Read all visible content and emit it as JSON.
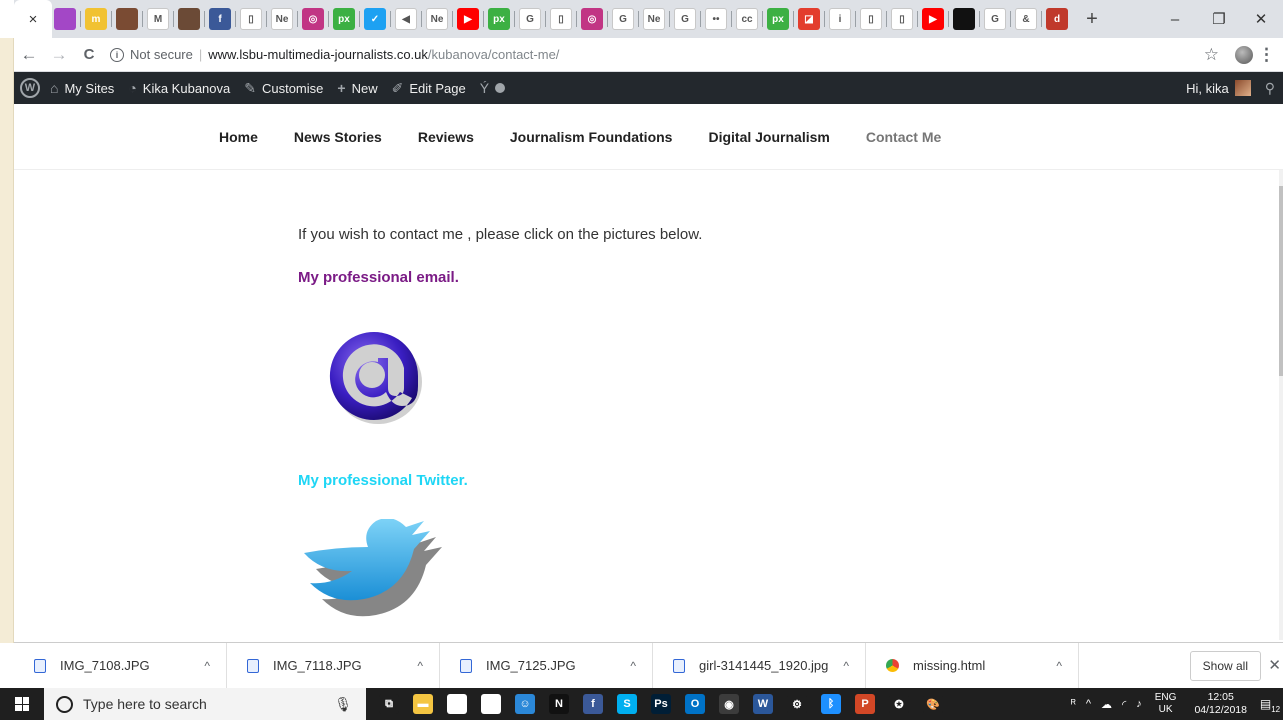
{
  "browser": {
    "active_tab_close": "×",
    "tabs": [
      {
        "icon": "purple-square-icon",
        "color": "#a347c6",
        "text": ""
      },
      {
        "icon": "site-logo-icon",
        "color": "#f1c232",
        "text": "m"
      },
      {
        "icon": "person-photo-icon",
        "color": "#7a4b33",
        "text": ""
      },
      {
        "icon": "gmail-icon",
        "color": "#ffffff",
        "text": "M"
      },
      {
        "icon": "person-photo-icon",
        "color": "#6b4a36",
        "text": ""
      },
      {
        "icon": "facebook-icon",
        "color": "#3b5998",
        "text": "f"
      },
      {
        "icon": "page-icon",
        "color": "#ffffff",
        "text": "▯"
      },
      {
        "icon": "ne-icon",
        "color": "#ffffff",
        "text": "Ne"
      },
      {
        "icon": "instagram-icon",
        "color": "#c13584",
        "text": "◎"
      },
      {
        "icon": "px-icon",
        "color": "#3cb043",
        "text": "px"
      },
      {
        "icon": "twitter-icon",
        "color": "#1da1f2",
        "text": "✓"
      },
      {
        "icon": "audio-icon",
        "color": "#ffffff",
        "text": "◀"
      },
      {
        "icon": "ne-icon",
        "color": "#ffffff",
        "text": "Ne"
      },
      {
        "icon": "youtube-icon",
        "color": "#ff0000",
        "text": "▶"
      },
      {
        "icon": "px-icon",
        "color": "#3cb043",
        "text": "px"
      },
      {
        "icon": "google-icon",
        "color": "#ffffff",
        "text": "G"
      },
      {
        "icon": "page-icon",
        "color": "#ffffff",
        "text": "▯"
      },
      {
        "icon": "instagram-icon",
        "color": "#c13584",
        "text": "◎"
      },
      {
        "icon": "google-icon",
        "color": "#ffffff",
        "text": "G"
      },
      {
        "icon": "ne-icon",
        "color": "#ffffff",
        "text": "Ne"
      },
      {
        "icon": "google-icon",
        "color": "#ffffff",
        "text": "G"
      },
      {
        "icon": "flickr-icon",
        "color": "#ffffff",
        "text": "••"
      },
      {
        "icon": "creative-commons-icon",
        "color": "#ffffff",
        "text": "cc"
      },
      {
        "icon": "px-icon",
        "color": "#3cb043",
        "text": "px"
      },
      {
        "icon": "red-app-icon",
        "color": "#e33d2d",
        "text": "◪"
      },
      {
        "icon": "info-icon",
        "color": "#ffffff",
        "text": "i"
      },
      {
        "icon": "page-icon",
        "color": "#ffffff",
        "text": "▯"
      },
      {
        "icon": "page-icon",
        "color": "#ffffff",
        "text": "▯"
      },
      {
        "icon": "youtube-icon",
        "color": "#ff0000",
        "text": "▶"
      },
      {
        "icon": "black-square-icon",
        "color": "#111111",
        "text": ""
      },
      {
        "icon": "google-icon",
        "color": "#ffffff",
        "text": "G"
      },
      {
        "icon": "link-icon",
        "color": "#ffffff",
        "text": "&"
      },
      {
        "icon": "red-circle-icon",
        "color": "#c0392b",
        "text": "d"
      }
    ],
    "new_tab": "+",
    "window_controls": {
      "minimize": "–",
      "maximize": "❐",
      "close": "✕"
    },
    "nav": {
      "back": "←",
      "forward": "→",
      "reload": "C"
    },
    "omnibox": {
      "security": "Not secure",
      "host": "www.lsbu-multimedia-journalists.co.uk",
      "path": "/kubanova/contact-me/"
    }
  },
  "wp_admin_bar": {
    "items": [
      {
        "icon": "sites-icon",
        "label": "My Sites"
      },
      {
        "icon": "dashboard-icon",
        "label": "Kika Kubanova"
      },
      {
        "icon": "brush-icon",
        "label": "Customise"
      },
      {
        "icon": "plus-icon",
        "label": "New"
      },
      {
        "icon": "pencil-icon",
        "label": "Edit Page"
      }
    ],
    "greeting": "Hi, kika"
  },
  "site_nav": {
    "items": [
      "Home",
      "News Stories",
      "Reviews",
      "Journalism Foundations",
      "Digital Journalism",
      "Contact Me"
    ],
    "current": "Contact Me"
  },
  "content": {
    "intro": "If you wish to contact me , please click on the pictures below.",
    "email_heading": "My professional email.",
    "twitter_heading": "My professional Twitter.",
    "colors": {
      "email_heading": "#7b1b86",
      "twitter_heading": "#1ed6f5"
    }
  },
  "downloads": {
    "files": [
      {
        "name": "IMG_7108.JPG",
        "icon": "image-file-icon"
      },
      {
        "name": "IMG_7118.JPG",
        "icon": "image-file-icon"
      },
      {
        "name": "IMG_7125.JPG",
        "icon": "image-file-icon"
      },
      {
        "name": "girl-3141445_1920.jpg",
        "icon": "image-file-icon"
      },
      {
        "name": "missing.html",
        "icon": "chrome-file-icon"
      }
    ],
    "show_all": "Show all"
  },
  "taskbar": {
    "search_placeholder": "Type here to search",
    "apps": [
      {
        "icon": "task-view-icon",
        "color": "#1f1f1f",
        "text": "⧉"
      },
      {
        "icon": "file-explorer-icon",
        "color": "#f4c542",
        "text": "▬"
      },
      {
        "icon": "store-icon",
        "color": "#ffffff",
        "text": "🛍"
      },
      {
        "icon": "mail-icon",
        "color": "#ffffff",
        "text": "✉"
      },
      {
        "icon": "people-icon",
        "color": "#2b88d8",
        "text": "☺"
      },
      {
        "icon": "netflix-icon",
        "color": "#111111",
        "text": "N"
      },
      {
        "icon": "facebook-icon",
        "color": "#3b5998",
        "text": "f"
      },
      {
        "icon": "skype-icon",
        "color": "#00aff0",
        "text": "S"
      },
      {
        "icon": "photoshop-icon",
        "color": "#001e36",
        "text": "Ps"
      },
      {
        "icon": "outlook-icon",
        "color": "#0072c6",
        "text": "O"
      },
      {
        "icon": "chrome-icon",
        "color": "#3c3c3c",
        "text": "◉"
      },
      {
        "icon": "word-icon",
        "color": "#2b579a",
        "text": "W"
      },
      {
        "icon": "settings-icon",
        "color": "#1f1f1f",
        "text": "⚙"
      },
      {
        "icon": "bluetooth-app-icon",
        "color": "#1e90ff",
        "text": "ᛒ"
      },
      {
        "icon": "powerpoint-icon",
        "color": "#d24726",
        "text": "P"
      },
      {
        "icon": "xbox-icon",
        "color": "#1f1f1f",
        "text": "✪"
      },
      {
        "icon": "paint-icon",
        "color": "#1f1f1f",
        "text": "🎨"
      }
    ],
    "language": {
      "top": "ENG",
      "bottom": "UK"
    },
    "time": "12:05",
    "date": "04/12/2018",
    "notifications": "12"
  }
}
